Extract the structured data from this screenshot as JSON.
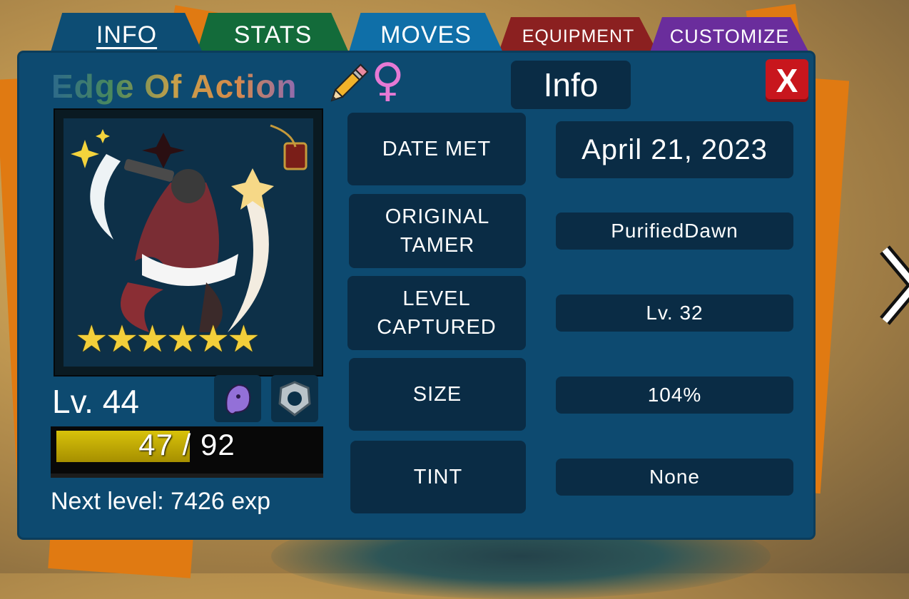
{
  "tabs": {
    "info": "INFO",
    "stats": "STATS",
    "moves": "MOVES",
    "equipment": "EQUIPMENT",
    "customize": "CUSTOMIZE"
  },
  "creature": {
    "name": "Edge Of Action",
    "gender_symbol": "♀",
    "level_label": "Lv. 44",
    "exp_current": 47,
    "exp_max": 92,
    "exp_text": "47 / 92",
    "next_level_text": "Next level: 7426 exp",
    "star_count": 6,
    "stars": "★★★★★★"
  },
  "panel": {
    "title": "Info",
    "close_label": "X"
  },
  "fields": {
    "date_met_label": "DATE MET",
    "date_met_value": "April 21, 2023",
    "original_tamer_label_1": "ORIGINAL",
    "original_tamer_label_2": "TAMER",
    "original_tamer_value": "PurifiedDawn",
    "level_captured_label_1": "LEVEL",
    "level_captured_label_2": "CAPTURED",
    "level_captured_value": "Lv. 32",
    "size_label": "SIZE",
    "size_value": "104%",
    "tint_label": "TINT",
    "tint_value": "None"
  },
  "icons": {
    "edit": "pencil-icon",
    "gender": "female-icon",
    "ability_1": "ghost-icon",
    "ability_2": "shield-icon",
    "next": "chevron-right-icon"
  },
  "colors": {
    "panel": "#0d4a70",
    "tab_info": "#0d4d74",
    "tab_stats": "#136b3a",
    "tab_moves": "#0f6fa8",
    "tab_equipment": "#8b2020",
    "tab_customize": "#6a2d9c",
    "close": "#c8161d",
    "exp_fill": "#d8c20a",
    "star": "#f3cf3a",
    "gender": "#e679d4"
  }
}
